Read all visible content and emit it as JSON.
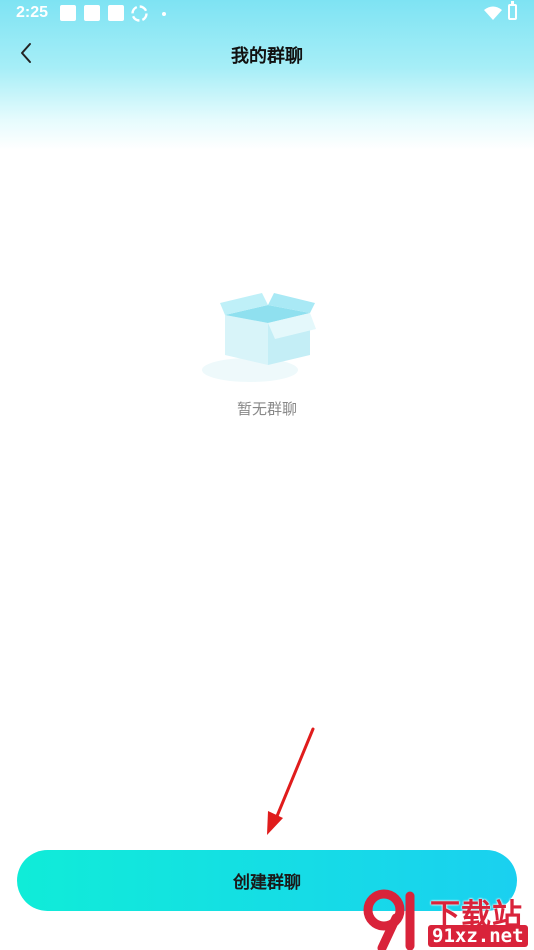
{
  "status_bar": {
    "time": "2:25"
  },
  "nav": {
    "title": "我的群聊"
  },
  "empty_state": {
    "text": "暂无群聊"
  },
  "actions": {
    "create_label": "创建群聊"
  },
  "watermark": {
    "title": "下载站",
    "domain": "91xz.net"
  },
  "colors": {
    "button_start": "#10ecd8",
    "button_end": "#1ad0f0",
    "header_top": "#7ee3f3",
    "watermark_red": "#d9233a"
  }
}
